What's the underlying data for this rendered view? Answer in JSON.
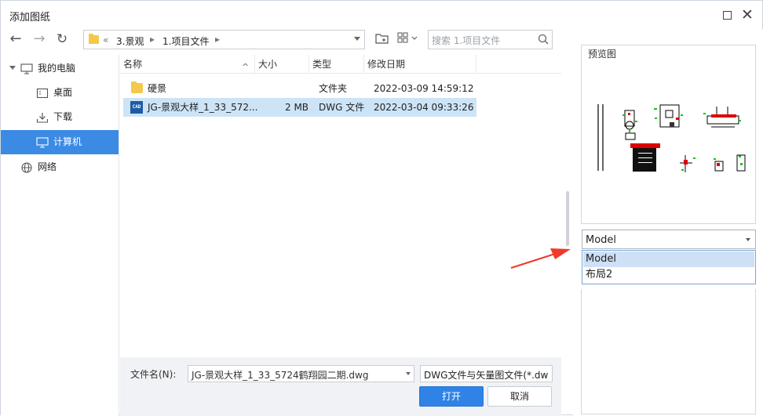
{
  "window": {
    "title": "添加图纸"
  },
  "toolbar": {
    "crumb_prefix": "«",
    "crumbs": [
      "3.景观",
      "1.项目文件"
    ],
    "search_placeholder": "搜索 1.项目文件"
  },
  "sidebar": {
    "items": [
      {
        "label": "我的电脑",
        "icon": "monitor-icon"
      },
      {
        "label": "桌面",
        "icon": "desktop-icon"
      },
      {
        "label": "下载",
        "icon": "download-icon"
      },
      {
        "label": "计算机",
        "icon": "computer-icon",
        "selected": true
      },
      {
        "label": "网络",
        "icon": "globe-icon"
      }
    ]
  },
  "files": {
    "columns": [
      "名称",
      "大小",
      "类型",
      "修改日期"
    ],
    "rows": [
      {
        "name": "硬景",
        "size": "",
        "type": "文件夹",
        "modified": "2022-03-09 14:59:12",
        "icon": "folder-icon"
      },
      {
        "name": "JG-景观大样_1_33_572...",
        "size": "2 MB",
        "type": "DWG 文件",
        "modified": "2022-03-04 09:33:26",
        "icon": "cad-file-icon",
        "icon_text": "CAD",
        "selected": true
      }
    ]
  },
  "bottom": {
    "filename_label": "文件名(N):",
    "filename_value": "JG-景观大样_1_33_5724鹤翔园二期.dwg",
    "filetype_value": "DWG文件与矢量图文件(*.dw",
    "open_label": "打开",
    "cancel_label": "取消"
  },
  "preview": {
    "label": "预览图",
    "layout_selected": "Model",
    "layout_options": [
      "Model",
      "布局2"
    ]
  },
  "colors": {
    "accent": "#3b8be5",
    "selection": "#cde4f7",
    "annotation_arrow": "#f03a2a"
  }
}
